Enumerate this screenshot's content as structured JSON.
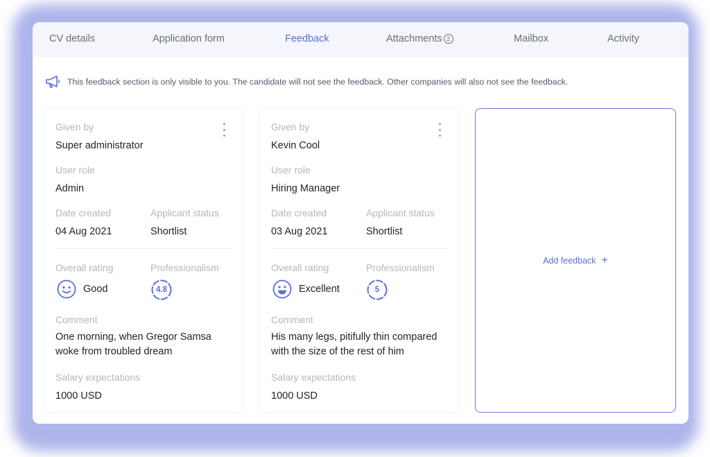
{
  "tabs": [
    {
      "label": "CV details"
    },
    {
      "label": "Application form"
    },
    {
      "label": "Feedback",
      "active": true
    },
    {
      "label": "Attachments",
      "badge": "2"
    },
    {
      "label": "Mailbox"
    },
    {
      "label": "Activity"
    }
  ],
  "notice": {
    "icon": "megaphone-icon",
    "text": "This feedback section is only visible to you. The candidate will not see the feedback. Other companies will also not see the feedback."
  },
  "labels": {
    "given_by": "Given by",
    "user_role": "User role",
    "date_created": "Date created",
    "applicant_status": "Applicant status",
    "overall_rating": "Overall rating",
    "professionalism": "Professionalism",
    "comment": "Comment",
    "salary_expectations": "Salary expectations"
  },
  "cards": [
    {
      "given_by": "Super administrator",
      "user_role": "Admin",
      "date_created": "04 Aug 2021",
      "applicant_status": "Shortlist",
      "overall_rating": "Good",
      "rating_icon": "smile-icon",
      "professionalism": "4.8",
      "comment": "One morning, when Gregor Samsa woke from troubled dream",
      "salary_expectations": "1000 USD"
    },
    {
      "given_by": "Kevin Cool",
      "user_role": "Hiring Manager",
      "date_created": "03 Aug 2021",
      "applicant_status": "Shortlist",
      "overall_rating": "Excellent",
      "rating_icon": "grin-icon",
      "professionalism": "5",
      "comment": "His many legs, pitifully thin compared with the size of the rest of him",
      "salary_expectations": "1000 USD"
    }
  ],
  "add_feedback": {
    "label": "Add feedback",
    "icon": "plus-icon"
  },
  "colors": {
    "accent": "#5c6ed8",
    "glow": "#aeb5ea"
  }
}
